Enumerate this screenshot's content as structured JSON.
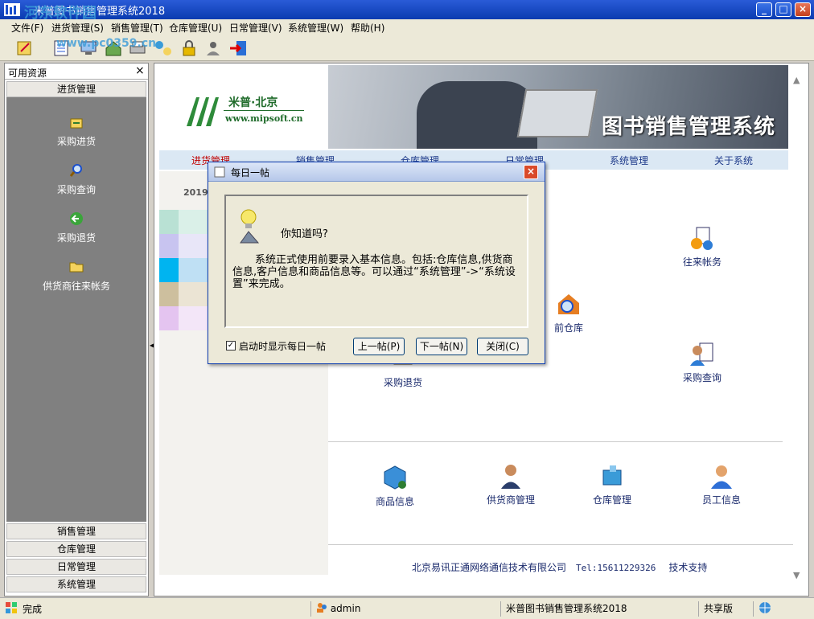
{
  "window": {
    "title": "米普图书销售管理系统2018"
  },
  "watermark": {
    "site": "河东软件园",
    "url": "www.pc0359.cn"
  },
  "menu": {
    "items": [
      "文件(F)",
      "进货管理(S)",
      "销售管理(T)",
      "仓库管理(U)",
      "日常管理(V)",
      "系统管理(W)",
      "帮助(H)"
    ]
  },
  "sidebar": {
    "header": "可用资源",
    "close": "×",
    "active_group": "进货管理",
    "items": [
      "采购进货",
      "采购查询",
      "采购退货",
      "供货商往来帐务"
    ],
    "groups": [
      "销售管理",
      "仓库管理",
      "日常管理",
      "系统管理"
    ]
  },
  "logo": {
    "company": "米普·北京",
    "url": "www.mipsoft.cn"
  },
  "banner": {
    "title": "图书销售管理系统"
  },
  "nav": {
    "items": [
      "进货管理",
      "销售管理",
      "仓库管理",
      "日常管理",
      "系统管理",
      "关于系统"
    ]
  },
  "left_block": {
    "date": "2019:"
  },
  "features": {
    "wanglai": "往来帐务",
    "cangku_partial": "前仓库",
    "tuihuo": "采购退货",
    "chaxun": "采购查询",
    "shangpin": "商品信息",
    "gonghuoshang": "供货商管理",
    "cangku": "仓库管理",
    "yuangong": "员工信息"
  },
  "footer": {
    "company": "北京易讯正通网络通信技术有限公司",
    "tel": "Tel:15611229326",
    "support": "技术支持"
  },
  "status": {
    "state": "完成",
    "user": "admin",
    "app": "米普图书销售管理系统2018",
    "edition": "共享版"
  },
  "dialog": {
    "title": "每日一帖",
    "heading": "你知道吗?",
    "body": "系统正式使用前要录入基本信息。包括:仓库信息,供货商信息,客户信息和商品信息等。可以通过“系统管理”->“系统设置”来完成。",
    "checkbox": "启动时显示每日一帖",
    "checked": true,
    "prev": "上一帖(P)",
    "next": "下一帖(N)",
    "close": "关闭(C)"
  },
  "colors": {
    "accent": "#0a3bb0",
    "nav_active": "#c00000",
    "sidebar_bg": "#808080"
  }
}
